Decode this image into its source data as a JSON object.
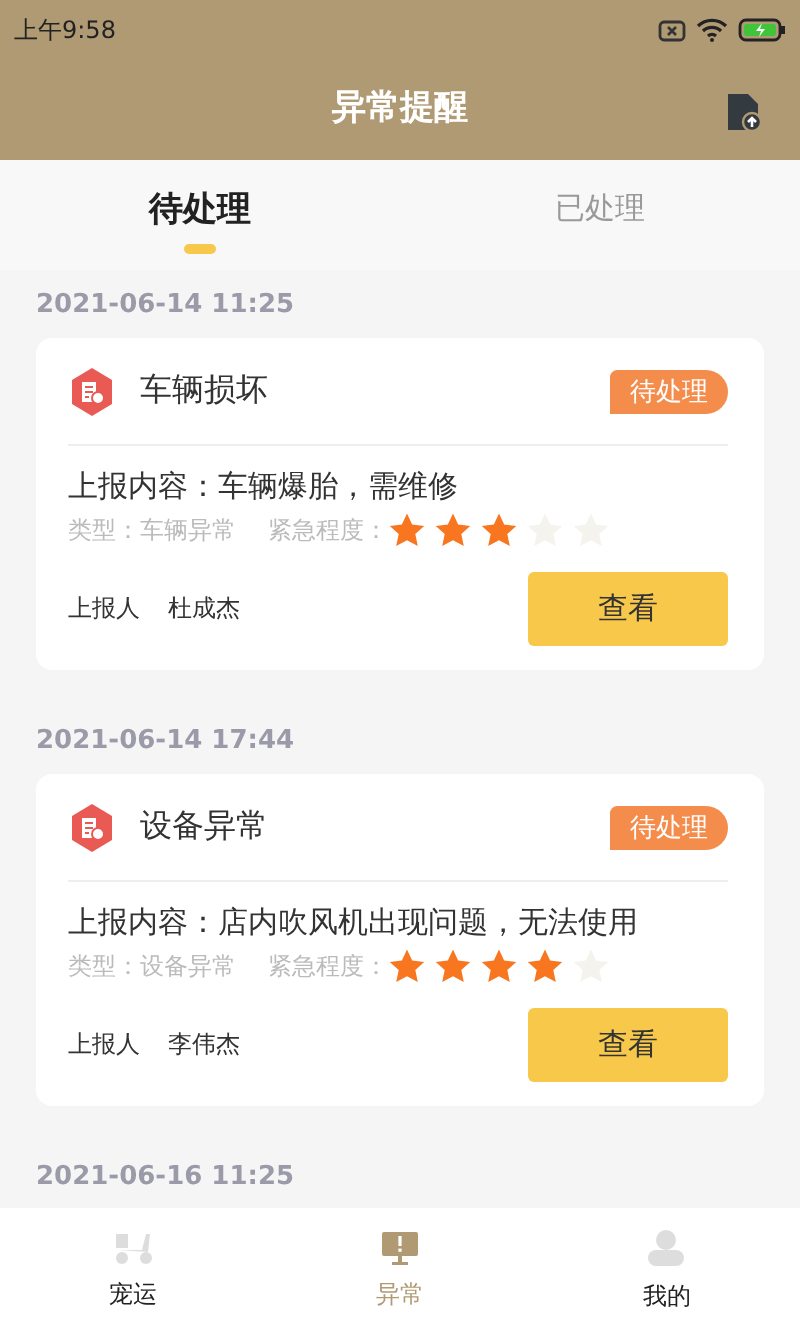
{
  "status_bar": {
    "time": "上午9:58"
  },
  "header": {
    "title": "异常提醒"
  },
  "tabs": [
    {
      "label": "待处理",
      "selected": true
    },
    {
      "label": "已处理",
      "selected": false
    }
  ],
  "groups": [
    {
      "date": "2021-06-14 11:25",
      "card": {
        "title": "车辆损坏",
        "badge": "待处理",
        "content": "上报内容：车辆爆胎，需维修",
        "type": "类型：车辆异常",
        "urgency_label": "紧急程度：",
        "stars": 3,
        "reporter_label": "上报人",
        "reporter": "杜成杰",
        "button": "查看"
      }
    },
    {
      "date": "2021-06-14 17:44",
      "card": {
        "title": "设备异常",
        "badge": "待处理",
        "content": "上报内容：店内吹风机出现问题，无法使用",
        "type": "类型：设备异常",
        "urgency_label": "紧急程度：",
        "stars": 4,
        "reporter_label": "上报人",
        "reporter": "李伟杰",
        "button": "查看"
      }
    },
    {
      "date": "2021-06-16 11:25"
    }
  ],
  "bottom_nav": [
    {
      "label": "宠运",
      "kind": "scooter",
      "selected": false
    },
    {
      "label": "异常",
      "kind": "alert",
      "selected": true
    },
    {
      "label": "我的",
      "kind": "person",
      "selected": false
    }
  ]
}
